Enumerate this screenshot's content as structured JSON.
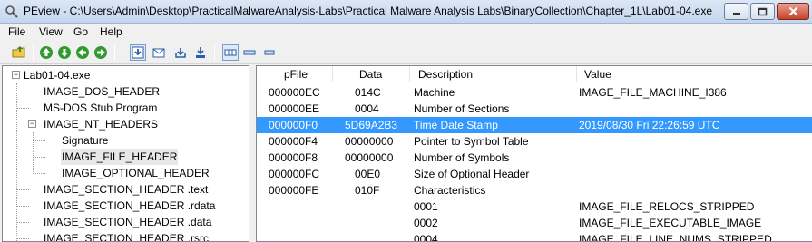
{
  "window": {
    "title": "PEview - C:\\Users\\Admin\\Desktop\\PracticalMalwareAnalysis-Labs\\Practical Malware Analysis Labs\\BinaryCollection\\Chapter_1L\\Lab01-04.exe"
  },
  "menu": [
    "File",
    "View",
    "Go",
    "Help"
  ],
  "tree": [
    {
      "label": "Lab01-04.exe"
    },
    {
      "label": "IMAGE_DOS_HEADER"
    },
    {
      "label": "MS-DOS Stub Program"
    },
    {
      "label": "IMAGE_NT_HEADERS"
    },
    {
      "label": "Signature"
    },
    {
      "label": "IMAGE_FILE_HEADER"
    },
    {
      "label": "IMAGE_OPTIONAL_HEADER"
    },
    {
      "label": "IMAGE_SECTION_HEADER .text"
    },
    {
      "label": "IMAGE_SECTION_HEADER .rdata"
    },
    {
      "label": "IMAGE_SECTION_HEADER .data"
    },
    {
      "label": "IMAGE_SECTION_HEADER .rsrc"
    }
  ],
  "table": {
    "columns": [
      "pFile",
      "Data",
      "Description",
      "Value"
    ],
    "rows": [
      {
        "pfile": "000000EC",
        "data": "014C",
        "description": "Machine",
        "value": "IMAGE_FILE_MACHINE_I386"
      },
      {
        "pfile": "000000EE",
        "data": "0004",
        "description": "Number of Sections",
        "value": ""
      },
      {
        "pfile": "000000F0",
        "data": "5D69A2B3",
        "description": "Time Date Stamp",
        "value": "2019/08/30 Fri 22:26:59 UTC"
      },
      {
        "pfile": "000000F4",
        "data": "00000000",
        "description": "Pointer to Symbol Table",
        "value": ""
      },
      {
        "pfile": "000000F8",
        "data": "00000000",
        "description": "Number of Symbols",
        "value": ""
      },
      {
        "pfile": "000000FC",
        "data": "00E0",
        "description": "Size of Optional Header",
        "value": ""
      },
      {
        "pfile": "000000FE",
        "data": "010F",
        "description": "Characteristics",
        "value": ""
      },
      {
        "pfile": "",
        "data": "",
        "description": "0001",
        "value": "IMAGE_FILE_RELOCS_STRIPPED"
      },
      {
        "pfile": "",
        "data": "",
        "description": "0002",
        "value": "IMAGE_FILE_EXECUTABLE_IMAGE"
      },
      {
        "pfile": "",
        "data": "",
        "description": "0004",
        "value": "IMAGE_FILE_LINE_NUMS_STRIPPED"
      }
    ]
  }
}
